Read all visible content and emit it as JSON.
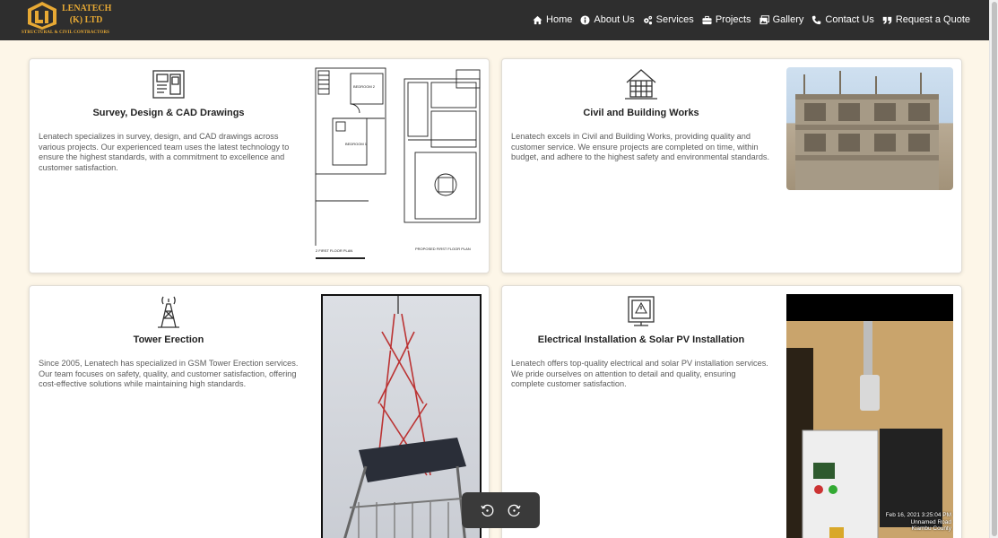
{
  "brand": {
    "name_line1": "LENATECH",
    "name_line2": "(K) LTD",
    "tagline": "STRUCTURAL & CIVIL CONTRACTORS"
  },
  "nav": [
    {
      "label": "Home",
      "icon": "home-icon"
    },
    {
      "label": "About Us",
      "icon": "info-icon"
    },
    {
      "label": "Services",
      "icon": "cogs-icon"
    },
    {
      "label": "Projects",
      "icon": "briefcase-icon"
    },
    {
      "label": "Gallery",
      "icon": "images-icon"
    },
    {
      "label": "Contact Us",
      "icon": "phone-icon"
    },
    {
      "label": "Request a Quote",
      "icon": "quote-icon"
    }
  ],
  "services": [
    {
      "title": "Survey, Design & CAD Drawings",
      "description": "Lenatech specializes in survey, design, and CAD drawings across various projects. Our experienced team uses the latest technology to ensure the highest standards, with a commitment to excellence and customer satisfaction.",
      "icon": "blueprint-icon",
      "plan_labels": [
        "BEDROOM 2",
        "BEDROOM 1",
        "2 FIRST FLOOR PLAN",
        "PROPOSED FIRST FLOOR PLAN"
      ]
    },
    {
      "title": "Civil and Building Works",
      "description": "Lenatech excels in Civil and Building Works, providing quality and customer service. We ensure projects are completed on time, within budget, and adhere to the highest safety and environmental standards.",
      "icon": "house-construction-icon"
    },
    {
      "title": "Tower Erection",
      "description": "Since 2005, Lenatech has specialized in GSM Tower Erection services. Our team focuses on safety, quality, and customer satisfaction, offering cost-effective solutions while maintaining high standards.",
      "icon": "tower-icon"
    },
    {
      "title": "Electrical Installation & Solar PV Installation",
      "description": "Lenatech offers top-quality electrical and solar PV installation services. We pride ourselves on attention to detail and quality, ensuring complete customer satisfaction.",
      "icon": "electrical-panel-icon",
      "photo_stamp": [
        "Feb 16, 2021 3:25:04 PM",
        "Unnamed Road",
        "Kiambu County"
      ]
    }
  ],
  "viewer": {
    "rotate_left_icon": "rotate-left-icon",
    "rotate_right_icon": "rotate-right-icon"
  }
}
